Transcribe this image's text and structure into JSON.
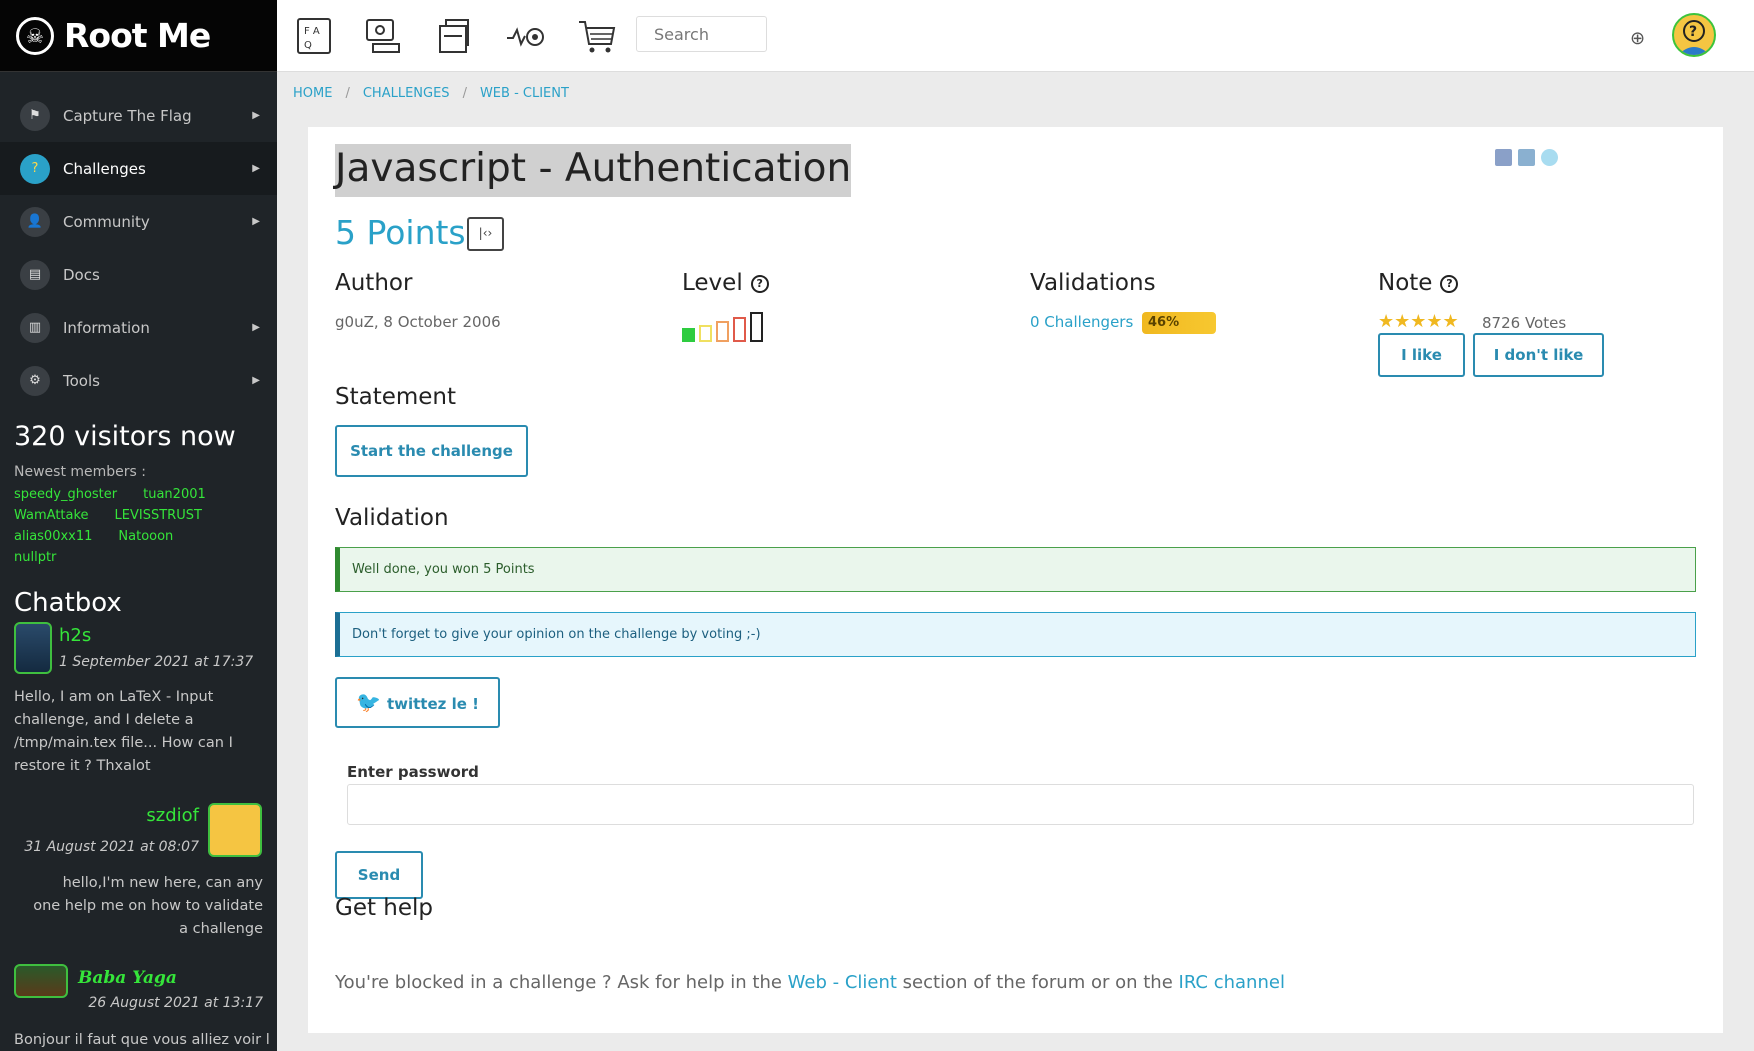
{
  "brand": {
    "name": "Root Me"
  },
  "sidebar": {
    "items": [
      {
        "label": "Capture The Flag",
        "icon": "flag-icon",
        "arrow": true
      },
      {
        "label": "Challenges",
        "icon": "challenges-icon",
        "arrow": true,
        "active": true
      },
      {
        "label": "Community",
        "icon": "community-icon",
        "arrow": true
      },
      {
        "label": "Docs",
        "icon": "docs-icon",
        "arrow": false
      },
      {
        "label": "Information",
        "icon": "information-icon",
        "arrow": true
      },
      {
        "label": "Tools",
        "icon": "tools-icon",
        "arrow": true
      }
    ],
    "visitors": "320 visitors now",
    "newest_label": "Newest members :",
    "members": [
      "speedy_ghoster",
      "tuan2001",
      "WamAttake",
      "LEVISSTRUST",
      "alias00xx11",
      "Natooon",
      "nullptr"
    ],
    "chatbox_title": "Chatbox",
    "chat": [
      {
        "name": "h2s",
        "date": "1 September 2021 at 17:37",
        "message": "Hello, I am on LaTeX - Input challenge, and I delete a /tmp/main.tex file... How can I restore it ? Thxalot"
      },
      {
        "name": "szdiof",
        "date": "31 August 2021 at 08:07",
        "message": "hello,I'm new here, can any one help me on how to validate a challenge"
      },
      {
        "name": "Baba Yaga",
        "date": "26 August 2021 at 13:17",
        "message": "Bonjour il faut que vous alliez voir la"
      }
    ]
  },
  "topbar": {
    "search_placeholder": "Search"
  },
  "breadcrumb": {
    "home": "HOME",
    "challenges": "CHALLENGES",
    "category": "WEB - CLIENT"
  },
  "challenge": {
    "title": "Javascript - Authentication",
    "points": "5 Points",
    "author_heading": "Author",
    "author_value": "g0uZ,  8 October 2006",
    "level_heading": "Level",
    "level": 1,
    "level_max": 5,
    "validations_heading": "Validations",
    "challengers": "0 Challengers",
    "success_rate": "46%",
    "note_heading": "Note",
    "stars": "★★★★★",
    "votes": "8726 Votes",
    "like_label": "I like",
    "dislike_label": "I don't like",
    "statement_heading": "Statement",
    "start_label": "Start the challenge",
    "validation_heading": "Validation",
    "success_msg": "Well done, you won 5 Points",
    "info_msg": "Don't forget to give your opinion on the challenge by voting ;-)",
    "tweet_label": "twittez le !",
    "password_label": "Enter password",
    "send_label": "Send",
    "help_heading": "Get help",
    "help_prefix": "You're blocked in a challenge ? Ask for help in the ",
    "help_link1": "Web - Client",
    "help_middle": " section of the forum or on the ",
    "help_link2": "IRC channel"
  },
  "colors": {
    "accent": "#2aa1c8",
    "sidebar_bg": "#1f2428",
    "member_green": "#35e53a",
    "badge_yellow": "#f0b820"
  }
}
